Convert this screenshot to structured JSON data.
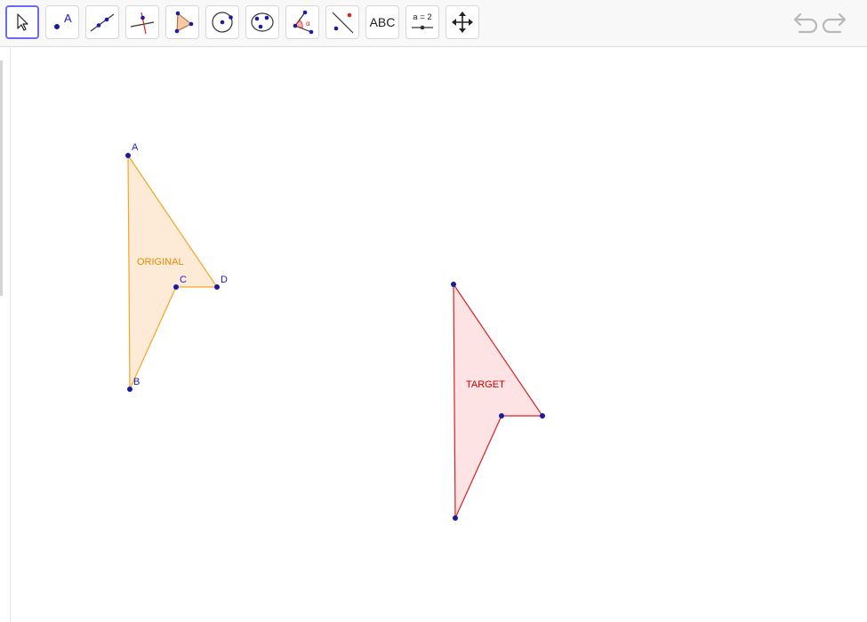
{
  "toolbar": {
    "tools": [
      {
        "name": "move",
        "label": ""
      },
      {
        "name": "point",
        "label": "A"
      },
      {
        "name": "line",
        "label": ""
      },
      {
        "name": "perpendicular-line",
        "label": ""
      },
      {
        "name": "polygon",
        "label": ""
      },
      {
        "name": "circle",
        "label": ""
      },
      {
        "name": "conic",
        "label": ""
      },
      {
        "name": "angle",
        "label": "α"
      },
      {
        "name": "reflect",
        "label": ""
      },
      {
        "name": "text",
        "label": "ABC"
      },
      {
        "name": "slider",
        "label": "a = 2"
      },
      {
        "name": "move-graphics-view",
        "label": ""
      }
    ],
    "selected": "move",
    "undo_icon": "undo-icon",
    "redo_icon": "redo-icon"
  },
  "graphics": {
    "original": {
      "caption": "ORIGINAL",
      "fill": "#fdebd8",
      "stroke": "#f5a623",
      "caption_color": "#e88a00",
      "points": [
        {
          "label": "A"
        },
        {
          "label": "B"
        },
        {
          "label": "C"
        },
        {
          "label": "D"
        }
      ]
    },
    "target": {
      "caption": "TARGET",
      "fill": "#fde3e3",
      "stroke": "#e02020",
      "caption_color": "#d00000"
    },
    "point_color": "#1a1aa8",
    "label_color": "#1a1ac8"
  }
}
